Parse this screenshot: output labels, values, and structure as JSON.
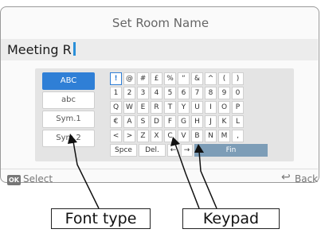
{
  "dialog": {
    "title": "Set Room Name",
    "name_value": "Meeting R"
  },
  "font_types": [
    {
      "label": "ABC",
      "active": true
    },
    {
      "label": "abc",
      "active": false
    },
    {
      "label": "Sym.1",
      "active": false
    },
    {
      "label": "Sym.2",
      "active": false
    }
  ],
  "keypad": {
    "rows": [
      [
        "!",
        "@",
        "#",
        "£",
        "%",
        "“",
        "&",
        "^",
        "(",
        ")"
      ],
      [
        "1",
        "2",
        "3",
        "4",
        "5",
        "6",
        "7",
        "8",
        "9",
        "0"
      ],
      [
        "Q",
        "W",
        "E",
        "R",
        "T",
        "Y",
        "U",
        "I",
        "O",
        "P"
      ],
      [
        "€",
        "A",
        "S",
        "D",
        "F",
        "G",
        "H",
        "J",
        "K",
        "L"
      ],
      [
        "<",
        ">",
        "Z",
        "X",
        "C",
        "V",
        "B",
        "N",
        "M",
        ","
      ]
    ],
    "space_label": "Spce",
    "delete_label": "Del.",
    "left_arrow": "←",
    "right_arrow": "→",
    "finish_label": "Fin"
  },
  "footer": {
    "ok_badge": "OK",
    "select_label": "Select",
    "back_icon": "↩",
    "back_label": "Back"
  },
  "callouts": {
    "font_type": "Font type",
    "keypad": "Keypad"
  },
  "colors": {
    "accent": "#2f7fd6",
    "finish_key": "#7d9db7",
    "cursor": "#2a8fd8"
  }
}
